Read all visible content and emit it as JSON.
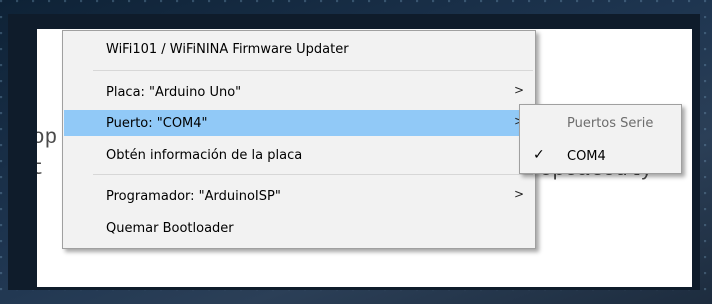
{
  "editor": {
    "fragments": [
      "op",
      "t",
      "repeatedly"
    ]
  },
  "menu": {
    "items": [
      {
        "label": "WiFi101 / WiFiNINA Firmware Updater"
      },
      {
        "label": "Placa: \"Arduino Uno\""
      },
      {
        "label": "Puerto: \"COM4\""
      },
      {
        "label": "Obtén información de la placa"
      },
      {
        "label": "Programador: \"ArduinoISP\""
      },
      {
        "label": "Quemar Bootloader"
      }
    ],
    "highlighted_item": "Puerto: \"COM4\""
  },
  "submenu": {
    "header": "Puertos Serie",
    "items": [
      {
        "label": "COM4",
        "checked": true
      }
    ]
  },
  "icons": {
    "submenu_arrow": "chevron-right-icon",
    "check": "check-icon"
  },
  "colors": {
    "highlight": "#91c9f7",
    "menu_background": "#f2f2f2"
  }
}
